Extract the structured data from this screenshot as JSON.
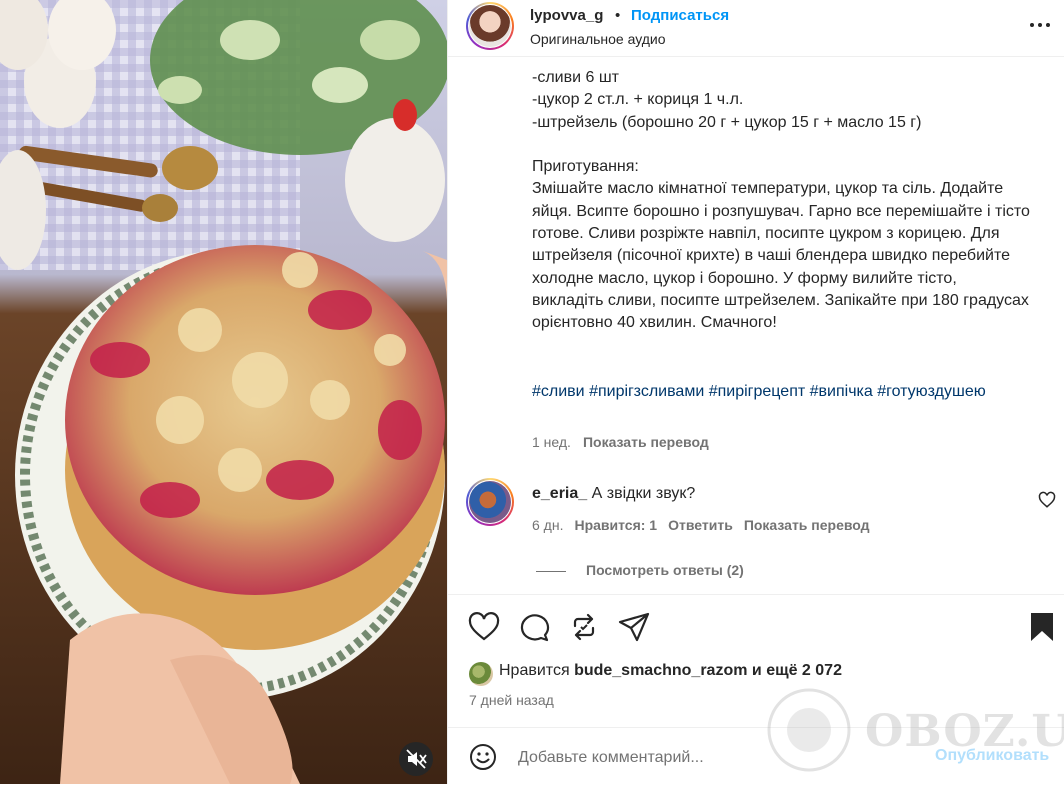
{
  "post": {
    "username": "lypovva_g",
    "separator": "•",
    "follow_label": "Подписаться",
    "audio_label": "Оригинальное аудио"
  },
  "caption": {
    "lines": [
      "-сливи 6 шт",
      "-цукор 2 ст.л. + кориця 1 ч.л.",
      "-штрейзель (борошно 20 г + цукор 15 г + масло 15 г)"
    ],
    "method_title": "Приготування:",
    "method_text": "Змішайте масло кімнатної температури, цукор та сіль. Додайте яйця. Всипте борошно і розпушувач. Гарно все перемішайте і тісто готове. Сливи розріжте навпіл, посипте цукром з корицею. Для штрейзеля (пісочної крихте) в чаші блендера швидко перебийте холодне масло, цукор і борошно. У форму вилийте тісто, викладіть сливи, посипте штрейзелем. Запікайте при 180 градусах орієнтовно 40 хвилин. Смачного!",
    "hashtags": [
      "#сливи",
      "#пирігзсливами",
      "#пирігрецепт",
      "#випічка",
      "#готуюздушею"
    ],
    "age": "1 нед.",
    "translate_label": "Показать перевод"
  },
  "comment": {
    "username": "e_eria_",
    "text": "А звідки звук?",
    "age": "6 дн.",
    "likes_label": "Нравится: 1",
    "reply_label": "Ответить",
    "translate_label": "Показать перевод",
    "view_replies_label": "Посмотреть ответы (2)"
  },
  "actions": {
    "icons": [
      "heart-icon",
      "comment-icon",
      "repost-icon",
      "share-icon",
      "bookmark-icon"
    ],
    "likes_prefix": "Нравится",
    "likes_user": "bude_smachno_razom",
    "likes_suffix": "и ещё 2 072",
    "posted_ago": "7 дней назад"
  },
  "comment_box": {
    "placeholder": "Добавьте комментарий...",
    "publish_label": "Опубликовать"
  },
  "watermark": {
    "text": "OBOZ.UA"
  },
  "colors": {
    "link": "#0095f6",
    "hashtag": "#00376b",
    "muted": "#737373",
    "publish_disabled": "#b2dffc"
  }
}
